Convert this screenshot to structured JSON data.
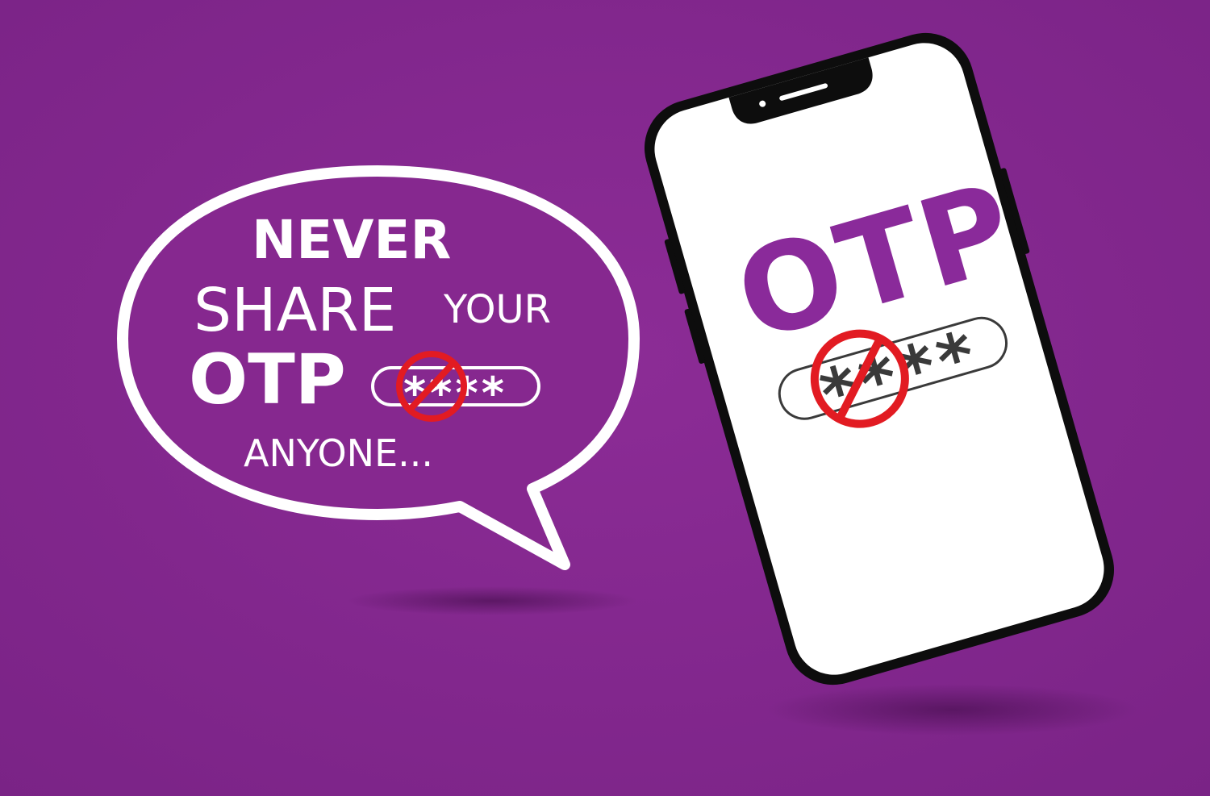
{
  "colors": {
    "background": "#86288f",
    "background_dark": "#6e1f78",
    "bubble_stroke": "#ffffff",
    "phone_body": "#0d0d0d",
    "phone_screen": "#ffffff",
    "otp_purple": "#8a2a9a",
    "prohibit_red": "#e21b22",
    "stars_dark": "#3a3a3a"
  },
  "bubble": {
    "line1": "NEVER",
    "line2_a": "SHARE",
    "line2_b": "YOUR",
    "line3": "OTP",
    "line4": "ANYONE...",
    "masked_code": "****"
  },
  "phone": {
    "title": "OTP",
    "masked_code": "****"
  },
  "icons": {
    "prohibit": "prohibit-icon",
    "speech_bubble": "speech-bubble-icon",
    "phone": "smartphone-icon"
  }
}
